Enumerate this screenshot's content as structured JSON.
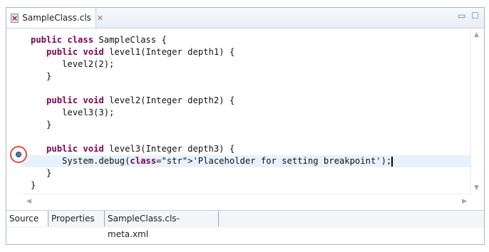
{
  "editor_tab": {
    "title": "SampleClass.cls",
    "icon": "apex-class-icon",
    "close_glyph": "✕"
  },
  "window_buttons": {
    "minimize": "▭",
    "maximize": "☐"
  },
  "code_lines": [
    "public class SampleClass {",
    "   public void level1(Integer depth1) {",
    "      level2(2);",
    "   }",
    "",
    "   public void level2(Integer depth2) {",
    "      level3(3);",
    "   }",
    "",
    "   public void level3(Integer depth3) {",
    "      System.debug('Placeholder for setting breakpoint');",
    "   }",
    "}"
  ],
  "highlighted_line_index": 10,
  "breakpoint": {
    "line_index": 10,
    "marker_color": "#5577aa",
    "callout_color": "#e74a3d"
  },
  "bottom_tabs": [
    {
      "label": "Source",
      "active": true
    },
    {
      "label": "Properties",
      "active": false
    },
    {
      "label": "SampleClass.cls-meta.xml",
      "active": false
    }
  ]
}
